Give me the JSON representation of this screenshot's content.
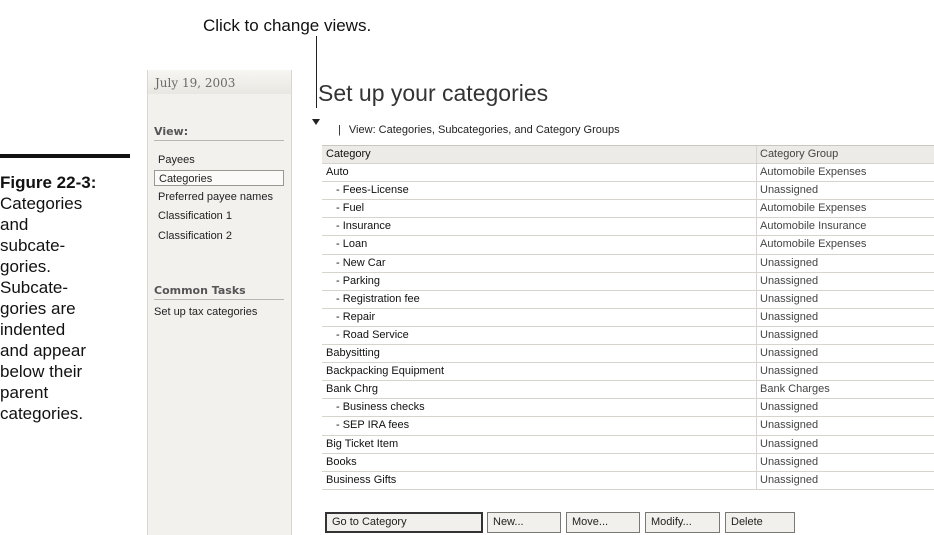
{
  "callout": "Click to change views.",
  "caption": {
    "figure": "Figure 22-3:",
    "text": "Categories\nand\nsubcate-\ngories.\nSubcate-\ngories are\nindented\nand appear\nbelow their\nparent\ncategories."
  },
  "sidebar": {
    "date": "July 19, 2003",
    "view_heading": "View:",
    "items": [
      {
        "label": "Payees",
        "selected": false
      },
      {
        "label": "Categories",
        "selected": true
      },
      {
        "label": "Preferred payee names",
        "selected": false
      },
      {
        "label": "Classification 1",
        "selected": false
      },
      {
        "label": "Classification 2",
        "selected": false
      }
    ],
    "tasks_heading": "Common Tasks",
    "tasks": [
      {
        "label": "Set up tax categories"
      }
    ]
  },
  "main": {
    "title": "Set up your categories",
    "view_label": "View: Categories, Subcategories, and Category Groups",
    "columns": [
      "Category",
      "Category Group"
    ],
    "rows": [
      {
        "category": "Auto",
        "group": "Automobile Expenses",
        "sub": false
      },
      {
        "category": "- Fees-License",
        "group": "Unassigned",
        "sub": true
      },
      {
        "category": "- Fuel",
        "group": "Automobile Expenses",
        "sub": true
      },
      {
        "category": "- Insurance",
        "group": "Automobile Insurance",
        "sub": true
      },
      {
        "category": "- Loan",
        "group": "Automobile Expenses",
        "sub": true
      },
      {
        "category": "- New Car",
        "group": "Unassigned",
        "sub": true
      },
      {
        "category": "- Parking",
        "group": "Unassigned",
        "sub": true
      },
      {
        "category": "- Registration fee",
        "group": "Unassigned",
        "sub": true
      },
      {
        "category": "- Repair",
        "group": "Unassigned",
        "sub": true
      },
      {
        "category": "- Road Service",
        "group": "Unassigned",
        "sub": true
      },
      {
        "category": "Babysitting",
        "group": "Unassigned",
        "sub": false
      },
      {
        "category": "Backpacking Equipment",
        "group": "Unassigned",
        "sub": false
      },
      {
        "category": "Bank Chrg",
        "group": "Bank Charges",
        "sub": false
      },
      {
        "category": "- Business checks",
        "group": "Unassigned",
        "sub": true
      },
      {
        "category": "- SEP IRA fees",
        "group": "Unassigned",
        "sub": true
      },
      {
        "category": "Big Ticket Item",
        "group": "Unassigned",
        "sub": false
      },
      {
        "category": "Books",
        "group": "Unassigned",
        "sub": false
      },
      {
        "category": "Business Gifts",
        "group": "Unassigned",
        "sub": false
      }
    ],
    "buttons": [
      "Go to Category",
      "New...",
      "Move...",
      "Modify...",
      "Delete"
    ]
  }
}
